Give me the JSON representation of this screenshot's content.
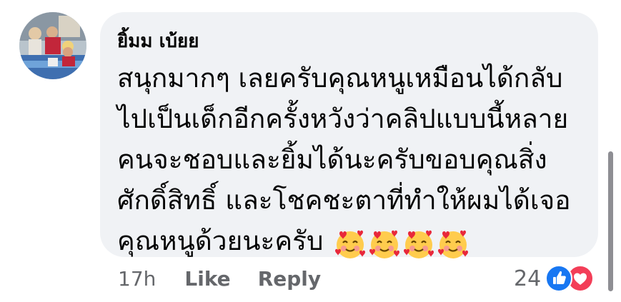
{
  "comment": {
    "author": "ยิ้มม เบ้ยย",
    "lines": [
      "สนุกมากๆ เลยครับคุณหนูเหมือนได้กลับ",
      "ไปเป็นเด็กอีกครั้งหวังว่าคลิปแบบนี้หลาย",
      "คนจะชอบและยิ้มได้นะครับขอบคุณสิ่ง",
      "ศักดิ์สิทธิ์ และโชคชะตาที่ทำให้ผมได้เจอ",
      "คุณหนูด้วยนะครับ"
    ],
    "emojis": [
      "smiling-face-with-hearts-icon",
      "smiling-face-with-hearts-icon",
      "smiling-face-with-hearts-icon",
      "smiling-face-with-hearts-icon"
    ]
  },
  "actions": {
    "time": "17h",
    "like_label": "Like",
    "reply_label": "Reply"
  },
  "reactions": {
    "count": "24",
    "types": [
      "like-icon",
      "love-icon"
    ]
  },
  "colors": {
    "bubble": "#f0f2f5",
    "text": "#050505",
    "meta": "#65676b",
    "like": "#1877f2",
    "love": "#f33e58"
  }
}
